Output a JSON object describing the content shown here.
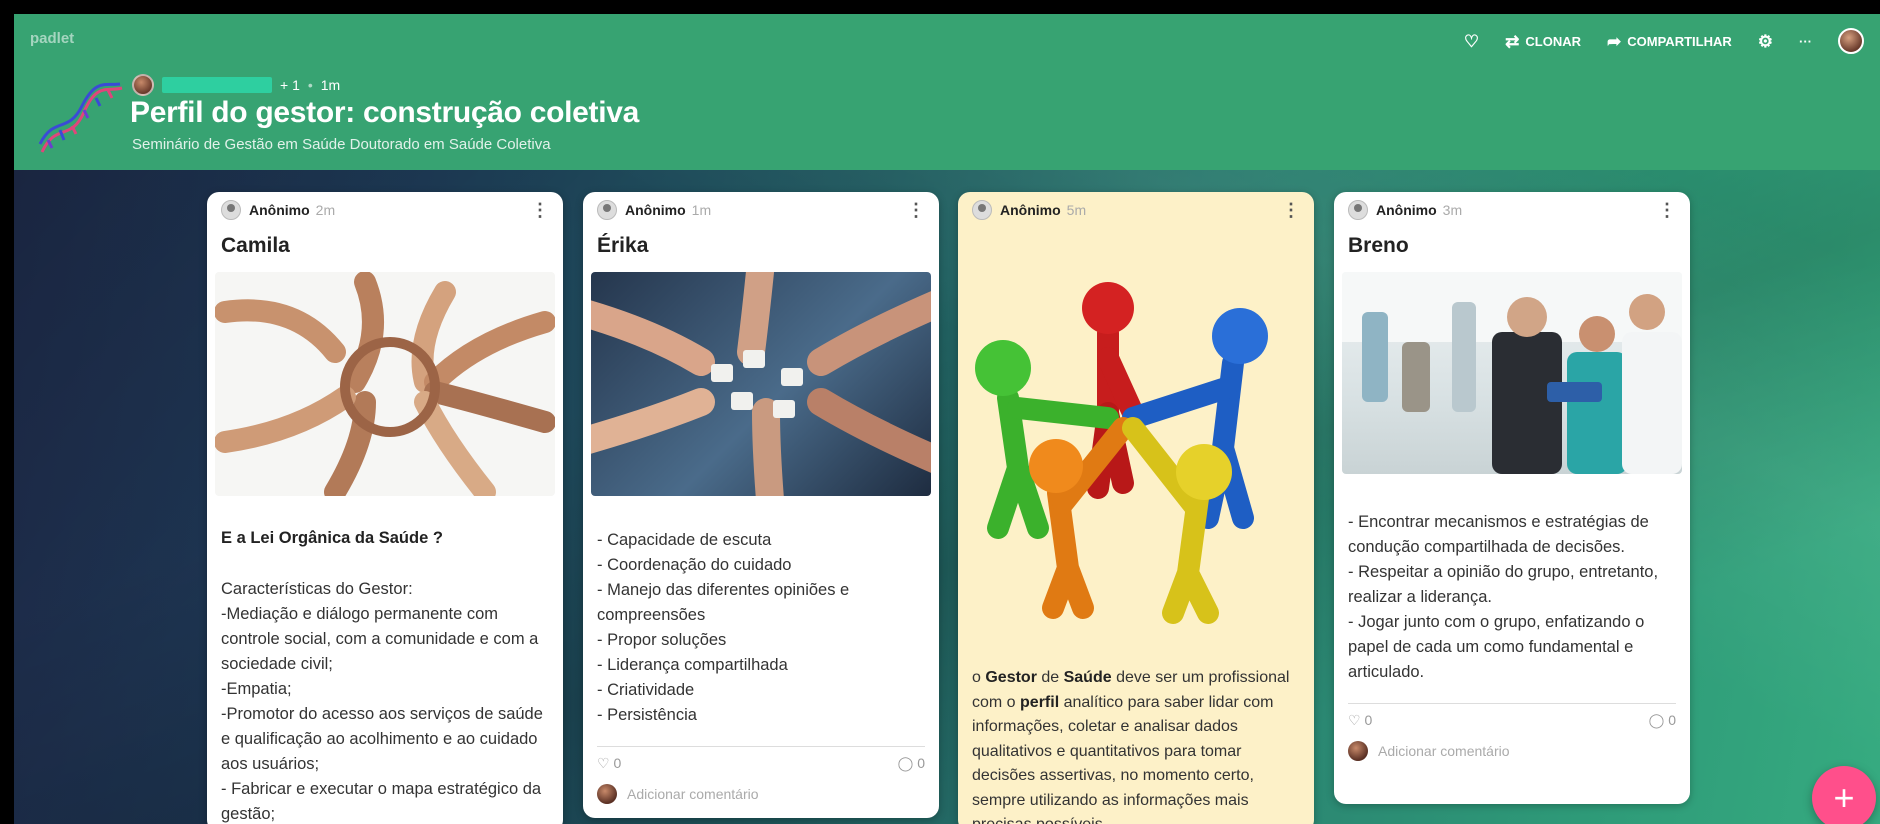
{
  "header": {
    "brand": "padlet",
    "meta_count": "+ 1",
    "meta_time": "1m",
    "title": "Perfil do gestor: construção coletiva",
    "subtitle": "Seminário de Gestão em Saúde Doutorado em Saúde Coletiva",
    "clone_label": "CLONAR",
    "share_label": "COMPARTILHAR",
    "more_label": "···"
  },
  "colors": {
    "header_bg": "#37a372",
    "fab": "#ff4f8b",
    "yellow_card": "#fdf1c8"
  },
  "cards": [
    {
      "author": "Anônimo",
      "ago": "2m",
      "title": "Camila",
      "heading": "E a Lei Orgânica da Saúde ?",
      "body": [
        "Características do Gestor:",
        "-Mediação e diálogo permanente com controle social, com a comunidade e com a sociedade civil;",
        "-Empatia;",
        "-Promotor do acesso aos serviços de saúde e qualificação ao acolhimento e ao cuidado aos usuários;",
        "- Fabricar e executar o mapa estratégico da gestão;"
      ]
    },
    {
      "author": "Anônimo",
      "ago": "1m",
      "title": "Érika",
      "body": [
        "- Capacidade de escuta",
        "- Coordenação do cuidado",
        "- Manejo das diferentes opiniões e compreensões",
        "- Propor soluções",
        "- Liderança compartilhada",
        "- Criatividade",
        "- Persistência"
      ],
      "likes": "0",
      "comments": "0",
      "add_comment": "Adicionar comentário"
    },
    {
      "author": "Anônimo",
      "ago": "5m",
      "body_parts": [
        "o ",
        "Gestor",
        " de ",
        "Saúde",
        " deve ser um profissional com o ",
        "perfil",
        " analítico para saber lidar com informações, coletar e analisar dados qualitativos e quantitativos para tomar decisões assertivas, no momento certo, sempre utilizando as informações mais precisas possíveis."
      ]
    },
    {
      "author": "Anônimo",
      "ago": "3m",
      "title": "Breno",
      "body": [
        "- Encontrar mecanismos e estratégias de condução compartilhada de decisões.",
        "- Respeitar a opinião do grupo, entretanto, realizar a liderança.",
        "- Jogar junto com o grupo, enfatizando o papel de cada um como fundamental e articulado."
      ],
      "likes": "0",
      "comments": "0",
      "add_comment": "Adicionar comentário"
    }
  ],
  "fab_label": "+"
}
